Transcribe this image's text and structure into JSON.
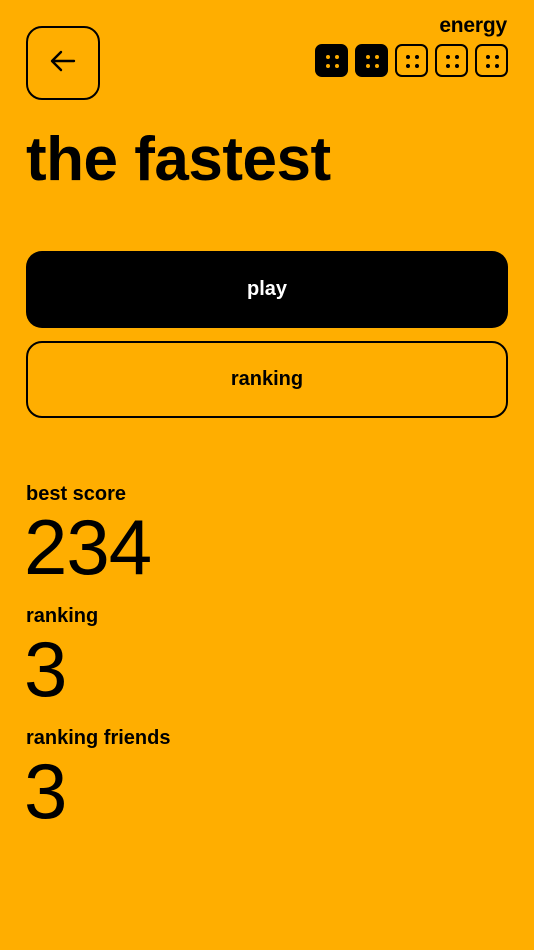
{
  "header": {
    "back_icon": "arrow-left-icon",
    "energy_label": "energy",
    "energy": {
      "max": 5,
      "filled": 2,
      "pip_icon": "four-dots-icon"
    }
  },
  "title": "the fastest",
  "actions": {
    "play_label": "play",
    "ranking_label": "ranking"
  },
  "stats": {
    "best_score_label": "best score",
    "best_score_value": "234",
    "ranking_label": "ranking",
    "ranking_value": "3",
    "ranking_friends_label": "ranking friends",
    "ranking_friends_value": "3"
  },
  "colors": {
    "background": "#FFAE00",
    "foreground": "#000000",
    "primary_button_text": "#FFFFFF"
  }
}
